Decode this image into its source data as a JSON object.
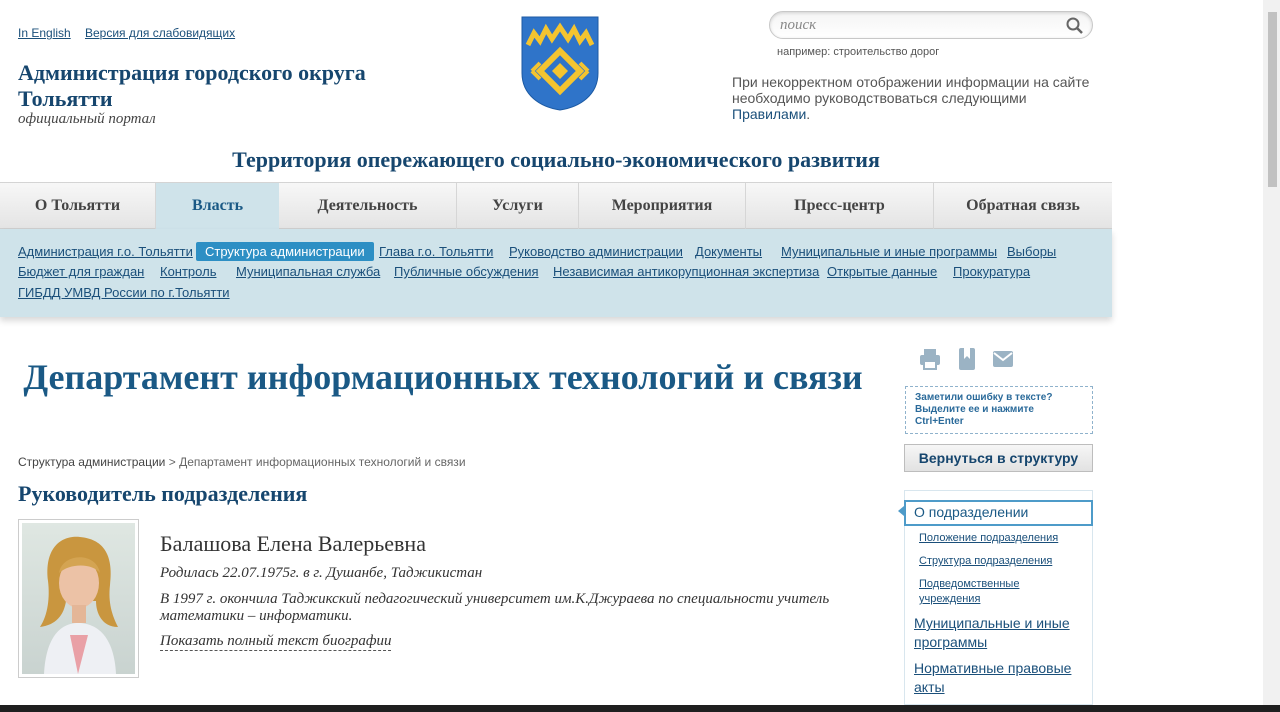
{
  "header": {
    "lang_link": "In English",
    "accessible_link": "Версия для слабовидящих",
    "title": "Администрация городского округа Тольятти",
    "subtitle": "официальный портал",
    "search_placeholder": "поиск",
    "search_hint_prefix": "например: ",
    "search_hint_example": "строительство дорог",
    "notice_text": "При некорректном отображении информации на сайте необходимо руководствоваться следующими ",
    "notice_link": "Правилами",
    "notice_end": ".",
    "slogan": "Территория опережающего социально-экономического развития"
  },
  "nav": {
    "items": [
      "О Тольятти",
      "Власть",
      "Деятельность",
      "Услуги",
      "Мероприятия",
      "Пресс-центр",
      "Обратная связь"
    ],
    "active": "Власть"
  },
  "subnav": {
    "items": [
      "Администрация г.о. Тольятти",
      "Структура администрации",
      "Глава г.о. Тольятти",
      "Руководство администрации",
      "Документы",
      "Муниципальные и иные программы",
      "Выборы",
      "Бюджет для граждан",
      "Контроль",
      "Муниципальная служба",
      "Публичные обсуждения",
      "Независимая антикорупционная экспертиза",
      "Открытые данные",
      "Прокуратура",
      "ГИБДД УМВД России по г.Тольятти"
    ],
    "active": "Структура администрации"
  },
  "main": {
    "dept_title": "Департамент информационных технологий и связи",
    "breadcrumb_link": "Структура администрации",
    "breadcrumb_sep": ">",
    "breadcrumb_current": "Департамент информационных технологий и связи",
    "section_title": "Руководитель подразделения",
    "person_name": "Балашова Елена Валерьевна",
    "born": "Родилась  22.07.1975г. в г. Душанбе, Таджикистан",
    "education": "В 1997 г. окончила Таджикский педагогический университет им.К.Джураева по специальности  учитель математики – информатики.",
    "show_more": "Показать полный текст биографии"
  },
  "sidebar": {
    "icons": [
      "print-icon",
      "bookmark-icon",
      "email-icon"
    ],
    "error_notice": "Заметили ошибку в тексте? Выделите ее и нажмите Ctrl+Enter",
    "back_button": "Вернуться в структуру",
    "menu_active": "О подразделении",
    "menu_sub": [
      "Положение подразделения",
      "Структура подразделения",
      "Подведомственные учреждения"
    ],
    "menu_main": [
      "Муниципальные и иные программы",
      "Нормативные правовые акты"
    ]
  },
  "colors": {
    "brand": "#16466e",
    "subnav_bg": "#cfe3ea",
    "active_sub": "#2d8fc4",
    "emblem_blue": "#2f74c9",
    "emblem_gold": "#f4c430"
  }
}
